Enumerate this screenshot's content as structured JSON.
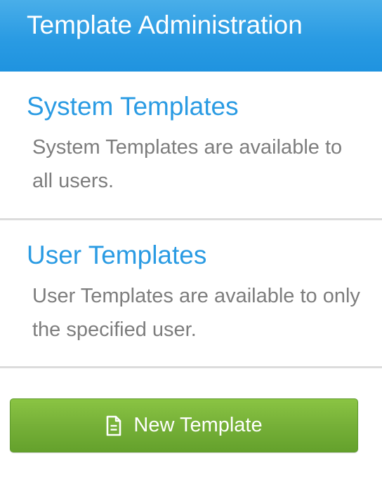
{
  "header": {
    "title": "Template Administration"
  },
  "sections": [
    {
      "title": "System Templates",
      "description": "System Templates are available to all users."
    },
    {
      "title": "User Templates",
      "description": "User Templates are available to only the specified user."
    }
  ],
  "actions": {
    "new_template_label": "New Template",
    "new_template_icon": "file-text-icon"
  },
  "colors": {
    "header_blue": "#2a9be3",
    "link_blue": "#2a9be3",
    "button_green": "#76b038",
    "description_gray": "#7d7d7d"
  }
}
